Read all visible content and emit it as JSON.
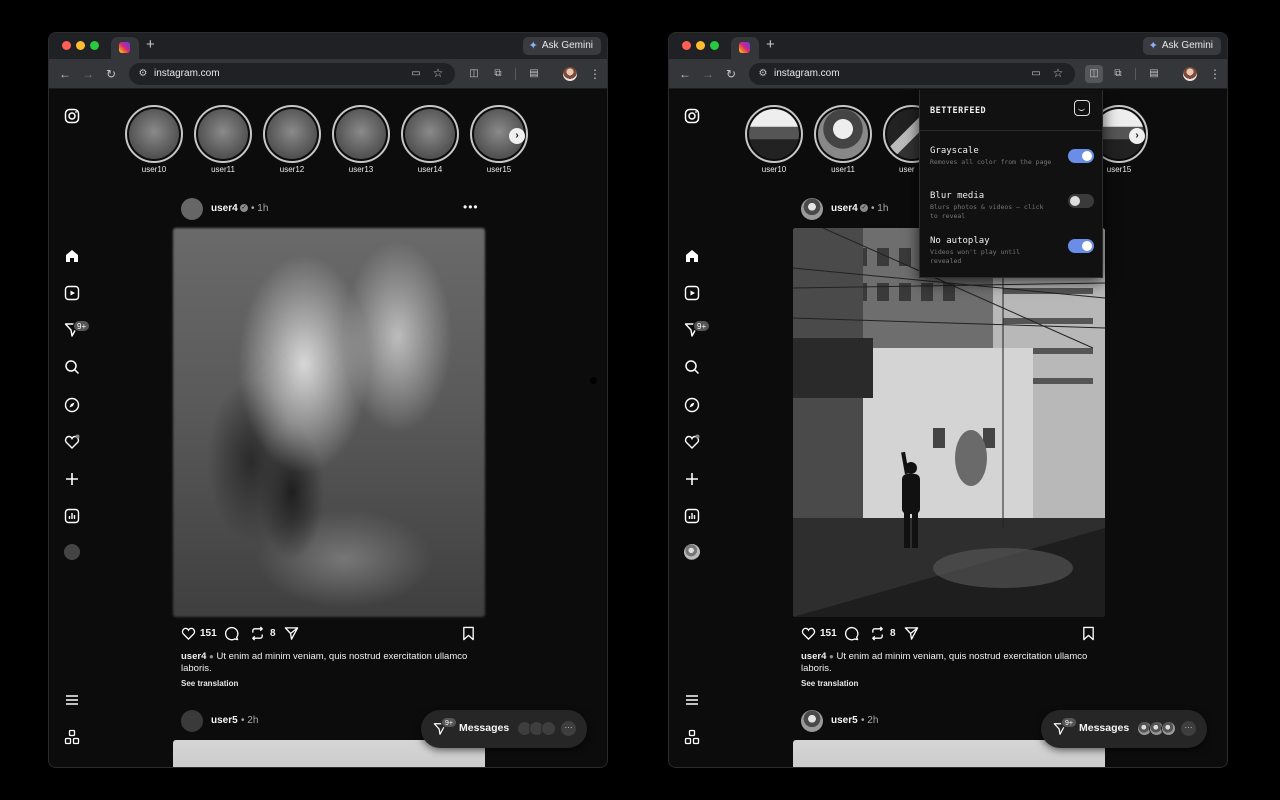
{
  "browser": {
    "url": "instagram.com",
    "gemini_label": "Ask Gemini",
    "new_tab": "+"
  },
  "sidebar": {
    "badge": "9+"
  },
  "stories": {
    "users": [
      "user10",
      "user11",
      "user12",
      "user13",
      "user14",
      "user15"
    ]
  },
  "post": {
    "username": "user4",
    "time": "1h",
    "likes": "151",
    "reposts": "8",
    "caption_user": "user4",
    "caption": "Ut enim ad minim veniam, quis nostrud exercitation ullamco laboris.",
    "see_translation": "See translation",
    "more": "•••"
  },
  "post2": {
    "username": "user5",
    "time": "2h"
  },
  "messages": {
    "label": "Messages",
    "badge": "9+",
    "more": "···"
  },
  "extension": {
    "title": "BETTERFEED",
    "options": [
      {
        "name": "Grayscale",
        "description": "Removes all color from the page",
        "enabled": true
      },
      {
        "name": "Blur media",
        "description": "Blurs photos & videos — click to reveal",
        "enabled": false
      },
      {
        "name": "No autoplay",
        "description": "Videos won't play until revealed",
        "enabled": true
      }
    ]
  }
}
